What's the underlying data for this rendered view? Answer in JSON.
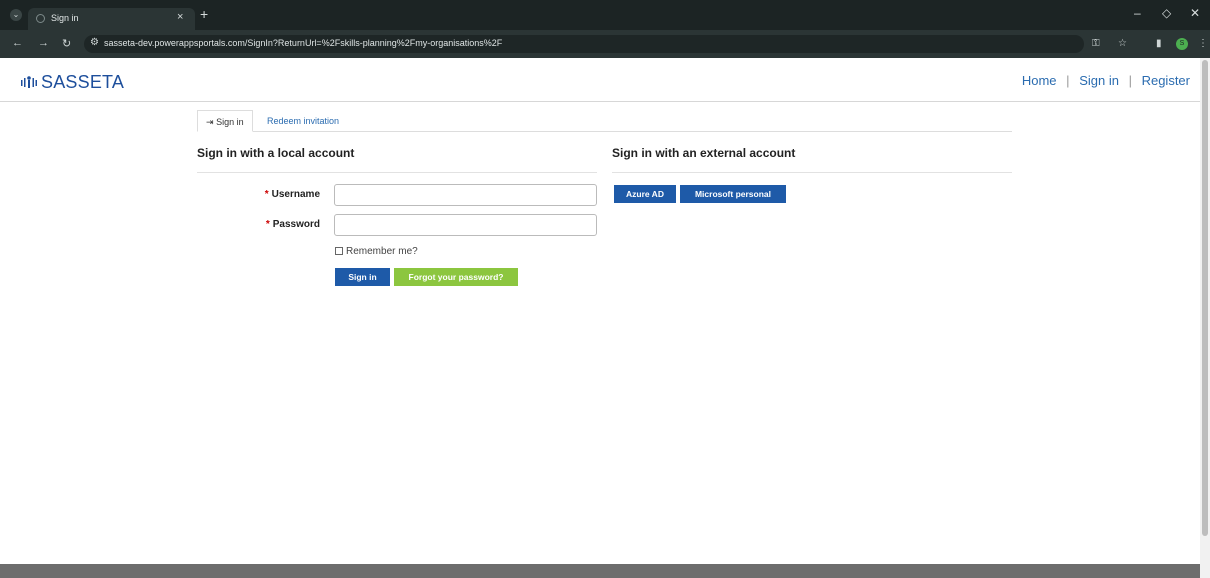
{
  "browser": {
    "tab_title": "Sign in",
    "url": "sasseta-dev.powerappsportals.com/SignIn?ReturnUrl=%2Fskills-planning%2Fmy-organisations%2F",
    "profile_letter": "S",
    "icons": [
      "tab-menu-icon",
      "favicon-icon",
      "close-tab-icon",
      "new-tab-icon",
      "minimize-icon",
      "restore-icon",
      "close-window-icon",
      "back-icon",
      "forward-icon",
      "reload-icon",
      "site-settings-icon",
      "key-icon",
      "star-icon",
      "sidepanel-icon",
      "more-icon"
    ]
  },
  "header": {
    "brand": "SASSETA",
    "nav": {
      "home": "Home",
      "sep": "|",
      "sign_in": "Sign in",
      "register": "Register"
    }
  },
  "tabs": {
    "sign_in": "Sign in",
    "redeem": "Redeem invitation"
  },
  "local": {
    "title": "Sign in with a local account",
    "required_marker": "*",
    "username_label": "Username",
    "password_label": "Password",
    "username_value": "",
    "password_value": "",
    "remember_label": "Remember me?",
    "sign_in_button": "Sign in",
    "forgot_button": "Forgot your password?"
  },
  "external": {
    "title": "Sign in with an external account",
    "azure_button": "Azure AD",
    "microsoft_button": "Microsoft personal"
  },
  "colors": {
    "brand": "#1e4f9c",
    "primary": "#1e5aa8",
    "secondary": "#8cc63f",
    "link": "#2b6cb0"
  }
}
